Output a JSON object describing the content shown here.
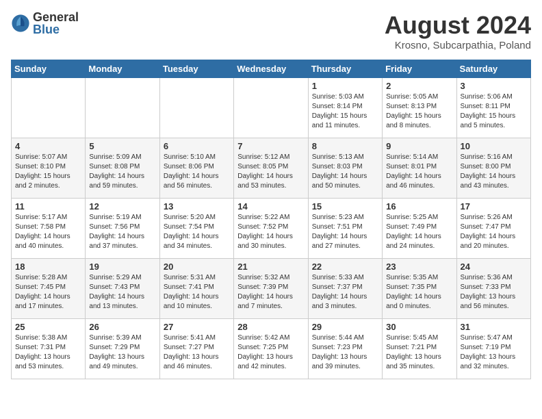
{
  "logo": {
    "general": "General",
    "blue": "Blue"
  },
  "title": {
    "month_year": "August 2024",
    "location": "Krosno, Subcarpathia, Poland"
  },
  "headers": [
    "Sunday",
    "Monday",
    "Tuesday",
    "Wednesday",
    "Thursday",
    "Friday",
    "Saturday"
  ],
  "weeks": [
    [
      {
        "day": "",
        "info": ""
      },
      {
        "day": "",
        "info": ""
      },
      {
        "day": "",
        "info": ""
      },
      {
        "day": "",
        "info": ""
      },
      {
        "day": "1",
        "info": "Sunrise: 5:03 AM\nSunset: 8:14 PM\nDaylight: 15 hours\nand 11 minutes."
      },
      {
        "day": "2",
        "info": "Sunrise: 5:05 AM\nSunset: 8:13 PM\nDaylight: 15 hours\nand 8 minutes."
      },
      {
        "day": "3",
        "info": "Sunrise: 5:06 AM\nSunset: 8:11 PM\nDaylight: 15 hours\nand 5 minutes."
      }
    ],
    [
      {
        "day": "4",
        "info": "Sunrise: 5:07 AM\nSunset: 8:10 PM\nDaylight: 15 hours\nand 2 minutes."
      },
      {
        "day": "5",
        "info": "Sunrise: 5:09 AM\nSunset: 8:08 PM\nDaylight: 14 hours\nand 59 minutes."
      },
      {
        "day": "6",
        "info": "Sunrise: 5:10 AM\nSunset: 8:06 PM\nDaylight: 14 hours\nand 56 minutes."
      },
      {
        "day": "7",
        "info": "Sunrise: 5:12 AM\nSunset: 8:05 PM\nDaylight: 14 hours\nand 53 minutes."
      },
      {
        "day": "8",
        "info": "Sunrise: 5:13 AM\nSunset: 8:03 PM\nDaylight: 14 hours\nand 50 minutes."
      },
      {
        "day": "9",
        "info": "Sunrise: 5:14 AM\nSunset: 8:01 PM\nDaylight: 14 hours\nand 46 minutes."
      },
      {
        "day": "10",
        "info": "Sunrise: 5:16 AM\nSunset: 8:00 PM\nDaylight: 14 hours\nand 43 minutes."
      }
    ],
    [
      {
        "day": "11",
        "info": "Sunrise: 5:17 AM\nSunset: 7:58 PM\nDaylight: 14 hours\nand 40 minutes."
      },
      {
        "day": "12",
        "info": "Sunrise: 5:19 AM\nSunset: 7:56 PM\nDaylight: 14 hours\nand 37 minutes."
      },
      {
        "day": "13",
        "info": "Sunrise: 5:20 AM\nSunset: 7:54 PM\nDaylight: 14 hours\nand 34 minutes."
      },
      {
        "day": "14",
        "info": "Sunrise: 5:22 AM\nSunset: 7:52 PM\nDaylight: 14 hours\nand 30 minutes."
      },
      {
        "day": "15",
        "info": "Sunrise: 5:23 AM\nSunset: 7:51 PM\nDaylight: 14 hours\nand 27 minutes."
      },
      {
        "day": "16",
        "info": "Sunrise: 5:25 AM\nSunset: 7:49 PM\nDaylight: 14 hours\nand 24 minutes."
      },
      {
        "day": "17",
        "info": "Sunrise: 5:26 AM\nSunset: 7:47 PM\nDaylight: 14 hours\nand 20 minutes."
      }
    ],
    [
      {
        "day": "18",
        "info": "Sunrise: 5:28 AM\nSunset: 7:45 PM\nDaylight: 14 hours\nand 17 minutes."
      },
      {
        "day": "19",
        "info": "Sunrise: 5:29 AM\nSunset: 7:43 PM\nDaylight: 14 hours\nand 13 minutes."
      },
      {
        "day": "20",
        "info": "Sunrise: 5:31 AM\nSunset: 7:41 PM\nDaylight: 14 hours\nand 10 minutes."
      },
      {
        "day": "21",
        "info": "Sunrise: 5:32 AM\nSunset: 7:39 PM\nDaylight: 14 hours\nand 7 minutes."
      },
      {
        "day": "22",
        "info": "Sunrise: 5:33 AM\nSunset: 7:37 PM\nDaylight: 14 hours\nand 3 minutes."
      },
      {
        "day": "23",
        "info": "Sunrise: 5:35 AM\nSunset: 7:35 PM\nDaylight: 14 hours\nand 0 minutes."
      },
      {
        "day": "24",
        "info": "Sunrise: 5:36 AM\nSunset: 7:33 PM\nDaylight: 13 hours\nand 56 minutes."
      }
    ],
    [
      {
        "day": "25",
        "info": "Sunrise: 5:38 AM\nSunset: 7:31 PM\nDaylight: 13 hours\nand 53 minutes."
      },
      {
        "day": "26",
        "info": "Sunrise: 5:39 AM\nSunset: 7:29 PM\nDaylight: 13 hours\nand 49 minutes."
      },
      {
        "day": "27",
        "info": "Sunrise: 5:41 AM\nSunset: 7:27 PM\nDaylight: 13 hours\nand 46 minutes."
      },
      {
        "day": "28",
        "info": "Sunrise: 5:42 AM\nSunset: 7:25 PM\nDaylight: 13 hours\nand 42 minutes."
      },
      {
        "day": "29",
        "info": "Sunrise: 5:44 AM\nSunset: 7:23 PM\nDaylight: 13 hours\nand 39 minutes."
      },
      {
        "day": "30",
        "info": "Sunrise: 5:45 AM\nSunset: 7:21 PM\nDaylight: 13 hours\nand 35 minutes."
      },
      {
        "day": "31",
        "info": "Sunrise: 5:47 AM\nSunset: 7:19 PM\nDaylight: 13 hours\nand 32 minutes."
      }
    ]
  ]
}
